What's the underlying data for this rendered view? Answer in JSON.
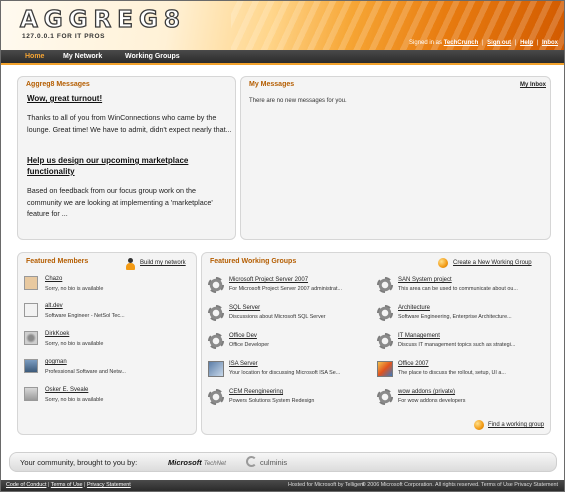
{
  "header": {
    "logo": "AGGREG8",
    "tagline": "127.0.0.1 FOR IT PROS",
    "signed_in_as": "Signed in as",
    "user": "TechCrunch",
    "sign_out": "Sign out",
    "help": "Help",
    "inbox": "Inbox",
    "separator": "|"
  },
  "nav": {
    "home": "Home",
    "my_network": "My Network",
    "working_groups": "Working Groups"
  },
  "aggreg8_messages": {
    "title": "Aggreg8 Messages",
    "items": [
      {
        "title": "Wow, great turnout!",
        "body": "Thanks to all of you from WinConnections who came by the lounge. Great time! We have to admit, didn't expect nearly that..."
      },
      {
        "title": "Help us design our upcoming marketplace functionality",
        "body": "Based on feedback from our focus group work on the community we are looking at implementing a 'marketplace' feature for ..."
      }
    ]
  },
  "my_messages": {
    "title": "My Messages",
    "inbox_link": "My Inbox",
    "empty_text": "There are no new messages for you."
  },
  "featured_members": {
    "title": "Featured Members",
    "build_link": "Build my network",
    "items": [
      {
        "name": "Chazo",
        "desc": "Sorry, no bio is available"
      },
      {
        "name": "alt.dev",
        "desc": "Software Engineer - NetSol Tec..."
      },
      {
        "name": "DirkKoek",
        "desc": "Sorry, no bio is available"
      },
      {
        "name": "gogman",
        "desc": "Professional Software and Netw..."
      },
      {
        "name": "Osker E. Sveale",
        "desc": "Sorry, no bio is available"
      }
    ]
  },
  "featured_groups": {
    "title": "Featured Working Groups",
    "create_link": "Create a New Working Group",
    "find_link": "Find a working group",
    "left": [
      {
        "name": "Microsoft Project Server 2007",
        "desc": "For Microsoft Project Server 2007 administrat..."
      },
      {
        "name": "SQL Server",
        "desc": "Discussions about Microsoft SQL Server"
      },
      {
        "name": "Office Dev",
        "desc": "Office Developer"
      },
      {
        "name": "ISA Server",
        "desc": "Your location for discussing Microsoft ISA Se..."
      },
      {
        "name": "CEM Reengineering",
        "desc": "Powers Solutions System Redesign"
      }
    ],
    "right": [
      {
        "name": "SAN System project",
        "desc": "This area can be used to communicate about ou..."
      },
      {
        "name": "Architecture",
        "desc": "Software Engineering, Enterprise Architecture..."
      },
      {
        "name": "IT Management",
        "desc": "Discuss IT management topics such as strategi..."
      },
      {
        "name": "Office 2007",
        "desc": "The place to discuss the rollout, setup, UI a..."
      },
      {
        "name": "wow addons (private)",
        "desc": "For wow addons developers"
      }
    ]
  },
  "footer": {
    "community_text": "Your community, brought to you by:",
    "microsoft": "Microsoft",
    "technet": "TechNet",
    "culminis": "culminis",
    "code_of_conduct": "Code of Conduct",
    "terms_of_use": "Terms of Use",
    "privacy": "Privacy Statement",
    "hosted": "Hosted for Microsoft by Telligent",
    "copyright": "© 2006 Microsoft Corporation. All rights reserved. Terms of Use Privacy Statement"
  }
}
